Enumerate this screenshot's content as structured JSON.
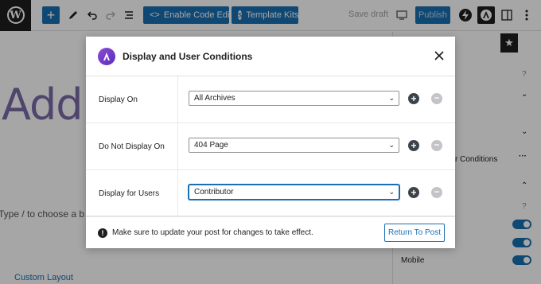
{
  "toolbar": {
    "enable_code_editor_label": "Enable Code Editor",
    "template_kits_label": "Template Kits",
    "save_draft_label": "Save draft",
    "publish_label": "Publish"
  },
  "editor": {
    "title_text": "Add t",
    "block_hint": "Type / to choose a b",
    "custom_layout_label": "Custom Layout"
  },
  "sidebar": {
    "conditions_label": "r Conditions",
    "mobile_label": "Mobile"
  },
  "modal": {
    "title": "Display and User Conditions",
    "rows": [
      {
        "label": "Display On",
        "value": "All Archives"
      },
      {
        "label": "Do Not Display On",
        "value": "404 Page"
      },
      {
        "label": "Display for Users",
        "value": "Contributor"
      }
    ],
    "footer_message": "Make sure to update your post for changes to take effect.",
    "return_label": "Return To Post"
  },
  "colors": {
    "accent": "#1a6fb3",
    "title_purple": "#7b6ba8"
  }
}
